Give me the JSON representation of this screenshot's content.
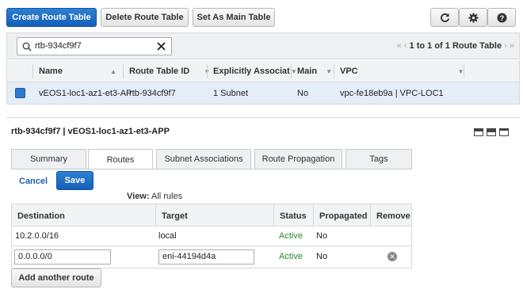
{
  "toolbar": {
    "create_label": "Create Route Table",
    "delete_label": "Delete Route Table",
    "set_main_label": "Set As Main Table",
    "refresh_icon": "refresh-icon",
    "settings_icon": "gear-icon",
    "help_icon": "help-icon"
  },
  "filter": {
    "search_value": "rtb-934cf9f7",
    "pager_text": "1 to 1 of 1 Route Table"
  },
  "grid": {
    "columns": [
      "Name",
      "Route Table ID",
      "Explicitly Associat",
      "Main",
      "VPC"
    ],
    "row": {
      "name": "vEOS1-loc1-az1-et3-AP",
      "route_table_id": "rtb-934cf9f7",
      "explicit": "1 Subnet",
      "main": "No",
      "vpc": "vpc-fe18eb9a | VPC-LOC1"
    }
  },
  "detail": {
    "title": "rtb-934cf9f7 | vEOS1-loc1-az1-et3-APP",
    "tabs": [
      "Summary",
      "Routes",
      "Subnet Associations",
      "Route Propagation",
      "Tags"
    ],
    "active_tab": "Routes",
    "cancel_label": "Cancel",
    "save_label": "Save",
    "view_label": "View:",
    "view_value": "All rules"
  },
  "routes": {
    "columns": [
      "Destination",
      "Target",
      "Status",
      "Propagated",
      "Remove"
    ],
    "rows": [
      {
        "destination": "10.2.0.0/16",
        "target": "local",
        "status": "Active",
        "propagated": "No"
      },
      {
        "destination": "0.0.0.0/0",
        "target": "eni-44194d4a",
        "status": "Active",
        "propagated": "No"
      }
    ],
    "add_label": "Add another route"
  },
  "colors": {
    "primary": "#1a6cc4",
    "active_status": "#2a8a2a",
    "selected_row": "#e4edf8"
  }
}
